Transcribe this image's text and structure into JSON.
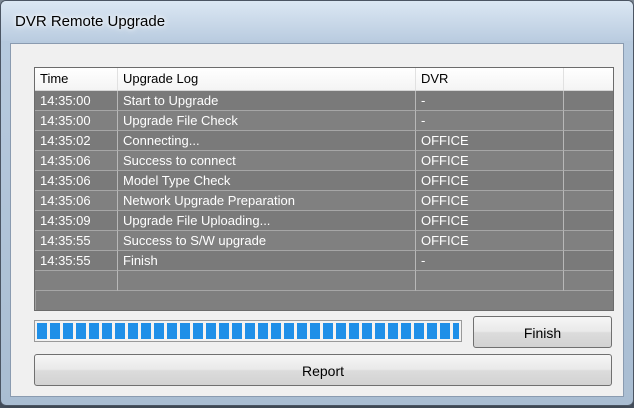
{
  "window": {
    "title": "DVR Remote Upgrade"
  },
  "log_table": {
    "columns": [
      "Time",
      "Upgrade Log",
      "DVR",
      ""
    ],
    "rows": [
      {
        "time": "14:35:00",
        "log": "Start to Upgrade",
        "dvr": "-"
      },
      {
        "time": "14:35:00",
        "log": "Upgrade File Check",
        "dvr": "-"
      },
      {
        "time": "14:35:02",
        "log": "Connecting...",
        "dvr": "OFFICE"
      },
      {
        "time": "14:35:06",
        "log": "Success to connect",
        "dvr": "OFFICE"
      },
      {
        "time": "14:35:06",
        "log": "Model Type Check",
        "dvr": "OFFICE"
      },
      {
        "time": "14:35:06",
        "log": "Network Upgrade Preparation",
        "dvr": "OFFICE"
      },
      {
        "time": "14:35:09",
        "log": "Upgrade File Uploading...",
        "dvr": "OFFICE"
      },
      {
        "time": "14:35:55",
        "log": "Success to S/W upgrade",
        "dvr": "OFFICE"
      },
      {
        "time": "14:35:55",
        "log": "Finish",
        "dvr": "-"
      },
      {
        "time": "",
        "log": "",
        "dvr": ""
      }
    ]
  },
  "progress": {
    "fraction": 1.0,
    "color": "#1e8fe8"
  },
  "buttons": {
    "finish_label": "Finish",
    "report_label": "Report"
  }
}
